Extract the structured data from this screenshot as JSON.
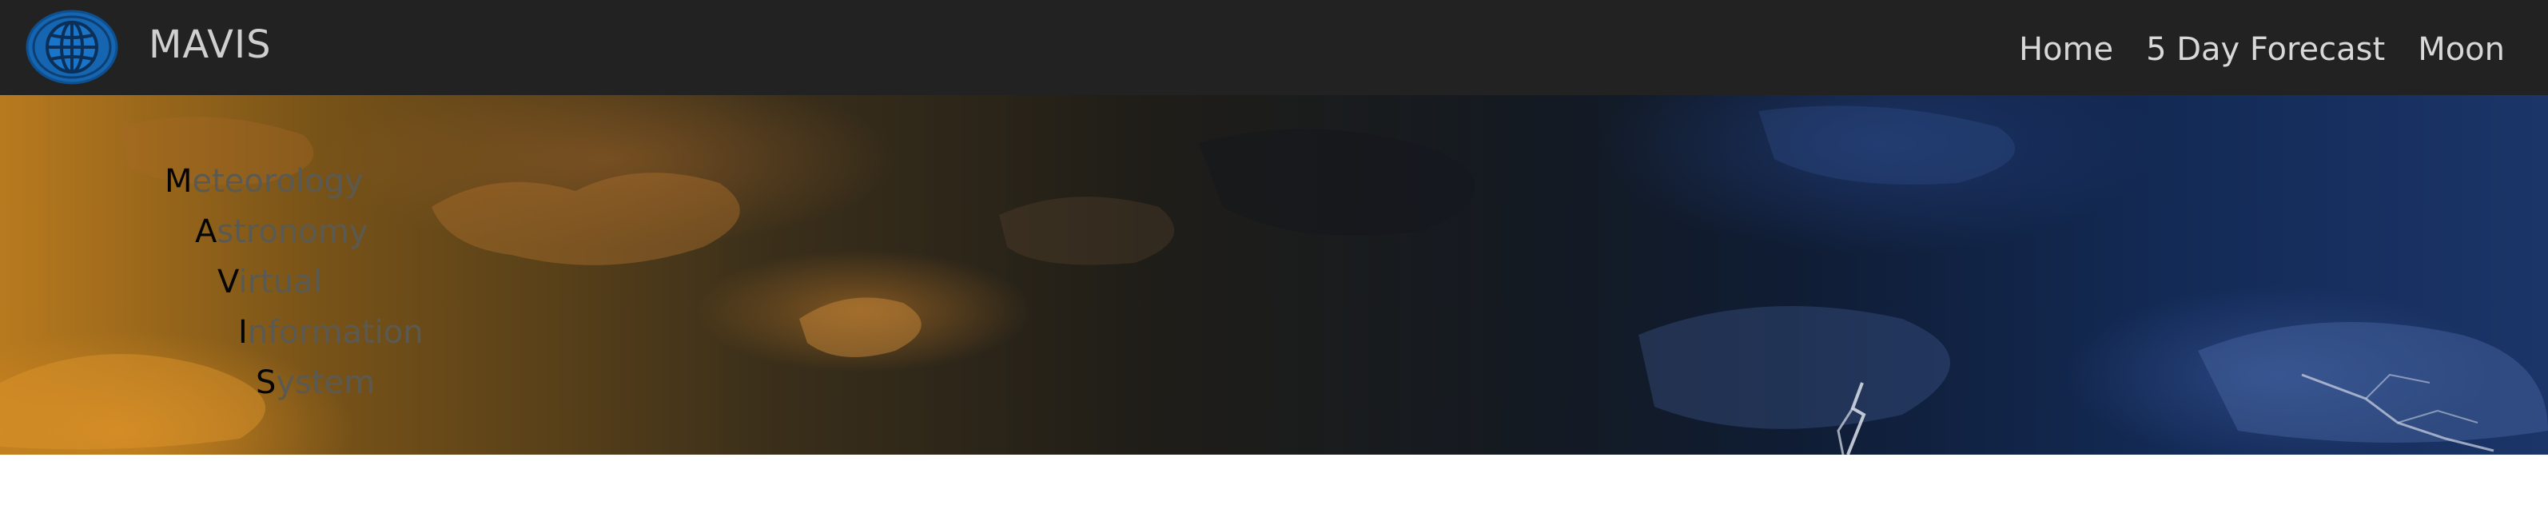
{
  "navbar": {
    "brand": "MAVIS",
    "logo_icon": "globe-icon",
    "links": [
      "Home",
      "5 Day Forecast",
      "Moon"
    ]
  },
  "hero": {
    "background": "storm-sky-lightning",
    "acronym": [
      {
        "initial": "M",
        "rest": "eteorology"
      },
      {
        "initial": "A",
        "rest": "stronomy"
      },
      {
        "initial": "V",
        "rest": "irtual"
      },
      {
        "initial": "I",
        "rest": "nformation"
      },
      {
        "initial": "S",
        "rest": "ystem"
      }
    ]
  },
  "colors": {
    "navbar_bg": "#222222",
    "logo_blue": "#1565b0",
    "nav_text": "#d8d8d8"
  }
}
